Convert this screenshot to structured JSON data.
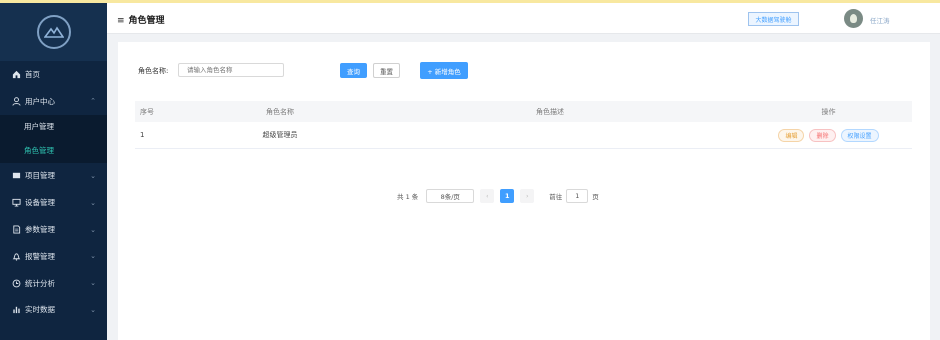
{
  "sidebar": {
    "items": [
      {
        "label": "首页",
        "icon": "home-icon",
        "arrow": ""
      },
      {
        "label": "用户中心",
        "icon": "user-icon",
        "arrow": "⌃"
      },
      {
        "label": "用户管理",
        "sub": true
      },
      {
        "label": "角色管理",
        "sub": true,
        "active": true
      },
      {
        "label": "项目管理",
        "icon": "folder-icon",
        "arrow": "⌄"
      },
      {
        "label": "设备管理",
        "icon": "monitor-icon",
        "arrow": "⌄"
      },
      {
        "label": "参数管理",
        "icon": "document-icon",
        "arrow": "⌄"
      },
      {
        "label": "报警管理",
        "icon": "bell-icon",
        "arrow": "⌄"
      },
      {
        "label": "统计分析",
        "icon": "clock-icon",
        "arrow": "⌄"
      },
      {
        "label": "实时数据",
        "icon": "bar-chart-icon",
        "arrow": "⌄"
      }
    ]
  },
  "header": {
    "title": "角色管理",
    "bigscreen_label": "大数据驾驶舱",
    "username": "任江涛"
  },
  "search": {
    "label": "角色名称:",
    "placeholder": "请输入角色名称",
    "query_label": "查询",
    "reset_label": "重置",
    "add_label": "+ 新增角色"
  },
  "table": {
    "columns": [
      "序号",
      "角色名称",
      "角色描述",
      "操作"
    ],
    "rows": [
      {
        "index": "1",
        "name": "超级管理员",
        "desc": ""
      }
    ],
    "actions": {
      "edit": "编辑",
      "delete": "删除",
      "perm": "权限设置"
    }
  },
  "pagination": {
    "total": "共 1 条",
    "page_size": "8条/页",
    "prev": "‹",
    "current": "1",
    "next": "›",
    "goto_label": "前往",
    "goto_value": "1",
    "page_suffix": "页"
  },
  "colors": {
    "sidebar": "#0f2540",
    "accent": "#409eff",
    "active": "#2fc4b2"
  }
}
